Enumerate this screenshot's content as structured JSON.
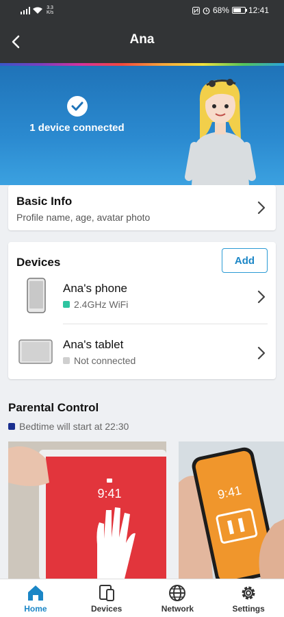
{
  "status_bar": {
    "speed_value": "3.3",
    "speed_unit": "K/s",
    "battery": "68%",
    "time": "12:41",
    "battery_level": 0.68
  },
  "header": {
    "title": "Ana"
  },
  "hero": {
    "connected_text": "1 device connected"
  },
  "basic_info": {
    "title": "Basic Info",
    "subtitle": "Profile name, age, avatar photo"
  },
  "devices": {
    "title": "Devices",
    "add_label": "Add",
    "items": [
      {
        "name": "Ana's phone",
        "status": "2.4GHz WiFi",
        "status_color": "#2ec4a0"
      },
      {
        "name": "Ana's tablet",
        "status": "Not connected",
        "status_color": "#cfcfcf"
      }
    ]
  },
  "parental_control": {
    "title": "Parental Control",
    "bedtime": "Bedtime will start at 22:30",
    "bedtime_color": "#1a2f8f",
    "card_times": [
      "9:41",
      "9:41"
    ]
  },
  "bottom_nav": {
    "items": [
      {
        "label": "Home",
        "icon": "home-icon",
        "active": true
      },
      {
        "label": "Devices",
        "icon": "devices-icon",
        "active": false
      },
      {
        "label": "Network",
        "icon": "globe-icon",
        "active": false
      },
      {
        "label": "Settings",
        "icon": "gear-icon",
        "active": false
      }
    ]
  },
  "colors": {
    "accent": "#1b86c6",
    "header_bg": "#323436"
  }
}
